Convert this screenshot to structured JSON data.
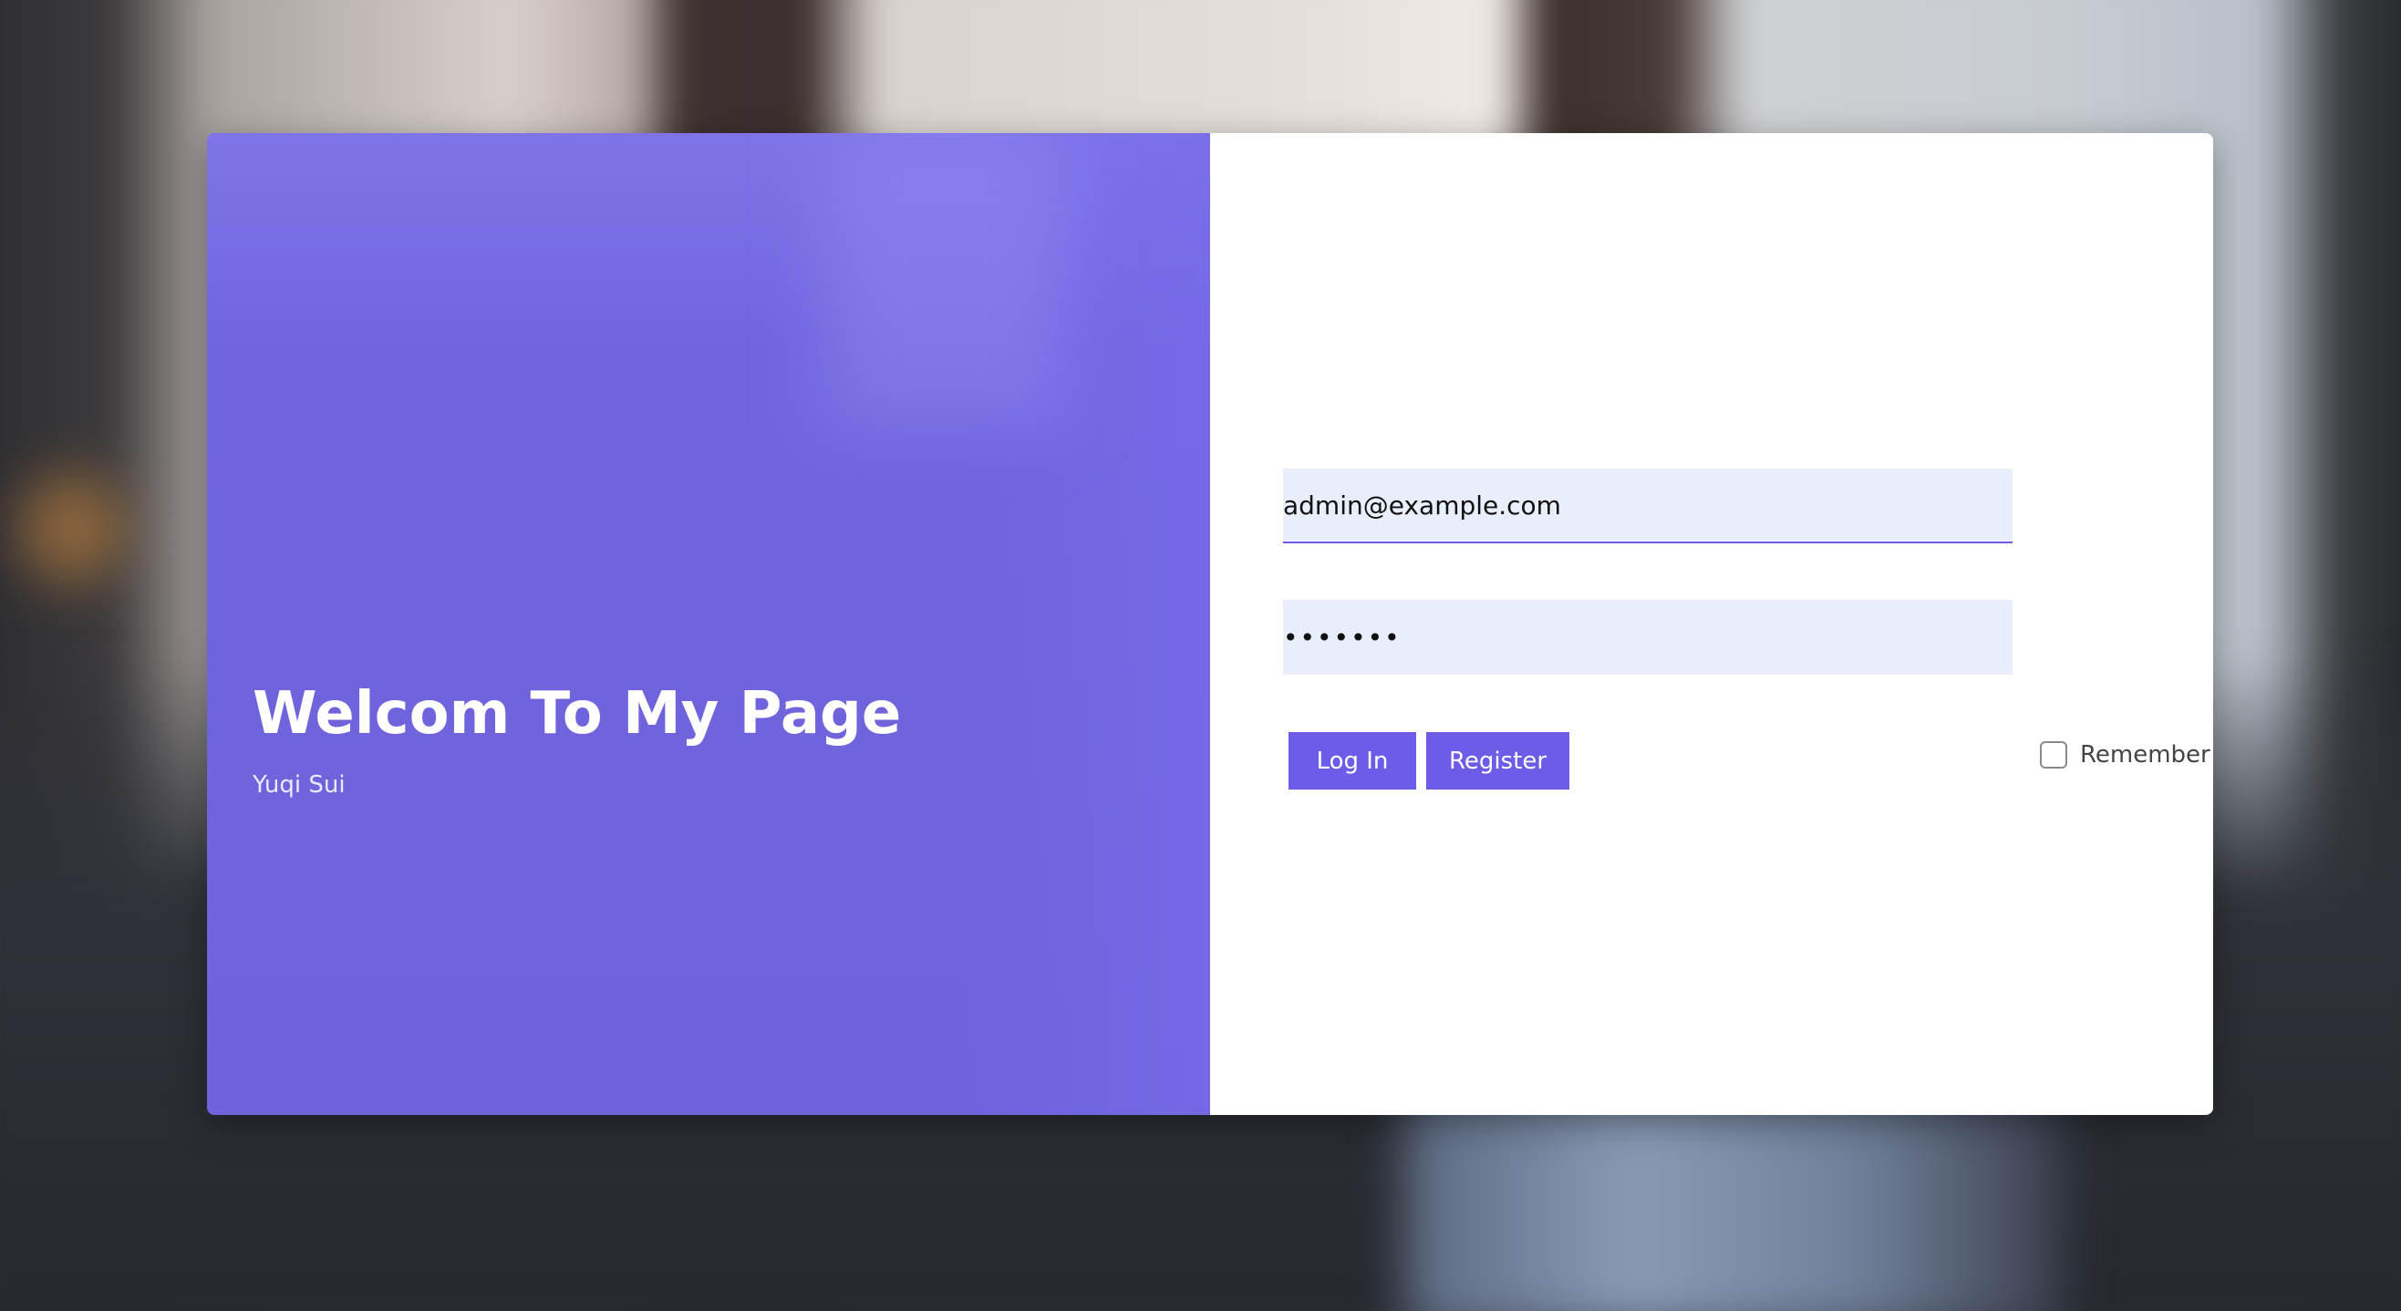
{
  "hero": {
    "title": "Welcom To My Page",
    "subtitle": "Yuqi Sui"
  },
  "form": {
    "email_value": "admin@example.com",
    "password_value": "•••••••",
    "login_label": "Log In",
    "register_label": "Register",
    "remember_label": "Remember",
    "remember_checked": false
  },
  "colors": {
    "accent": "#6c5ce7",
    "input_bg": "#e8eefb",
    "panel_left": "#7165de"
  }
}
